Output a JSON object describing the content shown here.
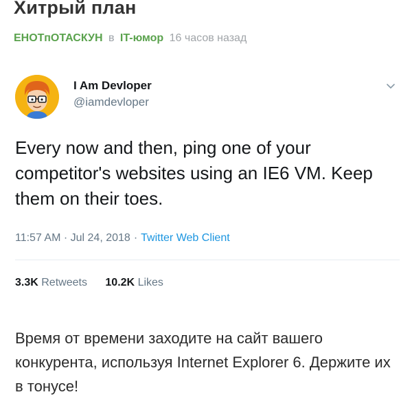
{
  "post": {
    "title": "Хитрый план",
    "author": "ЕНОТпОТАСКУН",
    "preposition": "в",
    "community": "IT-юмор",
    "time_ago": "16 часов назад"
  },
  "tweet": {
    "avatar_icon": "developer-avatar-icon",
    "user_name": "I Am Devloper",
    "handle": "@iamdevloper",
    "menu_icon": "chevron-down-icon",
    "text": "Every now and then, ping one of your competitor's websites using an IE6 VM. Keep them on their toes.",
    "timestamp": "11:57 AM · Jul 24, 2018",
    "separator": "·",
    "source": "Twitter Web Client",
    "retweets_count": "3.3K",
    "retweets_label": "Retweets",
    "likes_count": "10.2K",
    "likes_label": "Likes"
  },
  "caption": {
    "text": "Время от времени заходите на сайт вашего конкурента, используя Internet Explorer 6. Держите их в тонусе!"
  },
  "colors": {
    "pikabu_green": "#5aa24d",
    "twitter_blue": "#1b95e0",
    "avatar_bg": "#f5b312"
  }
}
